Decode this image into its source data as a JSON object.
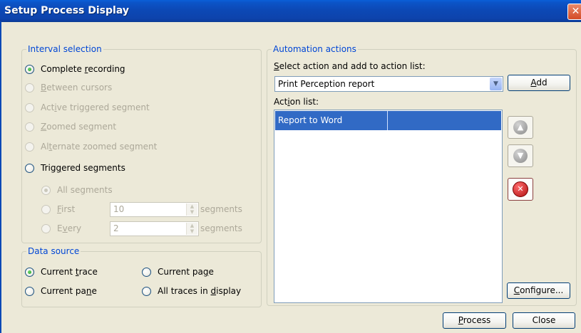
{
  "window": {
    "title": "Setup Process Display",
    "close_glyph": "✕"
  },
  "interval": {
    "legend": "Interval selection",
    "options": [
      {
        "pre": "Complete ",
        "key": "r",
        "post": "ecording"
      },
      {
        "pre": "",
        "key": "B",
        "post": "etween cursors"
      },
      {
        "pre": "Act",
        "key": "i",
        "post": "ve triggered segment"
      },
      {
        "pre": "",
        "key": "Z",
        "post": "oomed segment"
      },
      {
        "pre": "Al",
        "key": "t",
        "post": "ernate zoomed segment"
      },
      {
        "pre": "Trig",
        "key": "g",
        "post": "ered segments"
      }
    ],
    "sub": {
      "all_label": "All segments",
      "first": {
        "key": "F",
        "post": "irst",
        "value": "10",
        "unit": "segments"
      },
      "every": {
        "pre": "E",
        "key": "v",
        "post": "ery",
        "value": "2",
        "unit": "segments"
      }
    }
  },
  "datasource": {
    "legend": "Data source",
    "current_trace": {
      "pre": "Current ",
      "key": "t",
      "post": "race"
    },
    "current_page": {
      "pre": "Current pa",
      "key": "g",
      "post": "e"
    },
    "current_pane": {
      "pre": "Current pa",
      "key": "n",
      "post": "e"
    },
    "all_traces": {
      "pre": "All traces in ",
      "key": "d",
      "post": "isplay"
    }
  },
  "automation": {
    "legend": "Automation actions",
    "select_label": {
      "key": "S",
      "post": "elect action and add to action list:"
    },
    "selected_action": "Print Perception report",
    "add_button": {
      "key": "A",
      "post": "dd"
    },
    "list_label": {
      "pre": "Act",
      "key": "i",
      "post": "on list:"
    },
    "list_items": [
      "Report to Word"
    ],
    "configure_button": {
      "key": "C",
      "post": "onfigure..."
    }
  },
  "icons": {
    "move_up": "▲",
    "move_down": "▼",
    "remove": "✕",
    "dropdown": "▼"
  },
  "footer": {
    "process_button": {
      "key": "P",
      "post": "rocess"
    },
    "close_button": "Close"
  }
}
